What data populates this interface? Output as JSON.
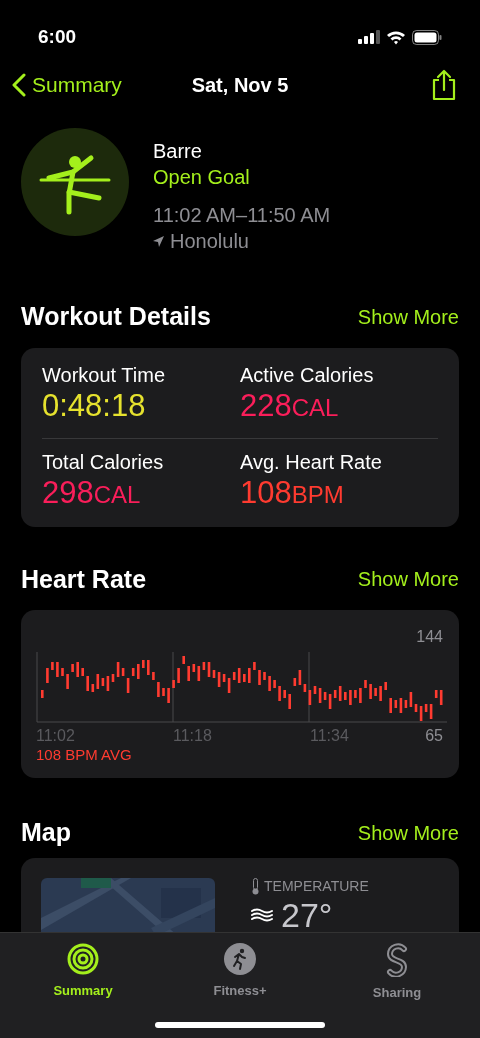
{
  "status_bar": {
    "time": "6:00"
  },
  "nav": {
    "back": "Summary",
    "title": "Sat, Nov 5"
  },
  "workout": {
    "name": "Barre",
    "goal": "Open Goal",
    "time_range": "11:02 AM–11:50 AM",
    "location": "Honolulu"
  },
  "details": {
    "title": "Workout Details",
    "action": "Show More",
    "metrics": [
      {
        "label": "Workout Time",
        "value": "0:48:18",
        "color": "#e6e22e"
      },
      {
        "label": "Active Calories",
        "value": "228",
        "unit": "CAL",
        "color": "#fa1e5a"
      },
      {
        "label": "Total Calories",
        "value": "298",
        "unit": "CAL",
        "color": "#fa1e5a"
      },
      {
        "label": "Avg. Heart Rate",
        "value": "108",
        "unit": "BPM",
        "color": "#ff3b30"
      }
    ]
  },
  "heart_rate": {
    "title": "Heart Rate",
    "action": "Show More",
    "max": "144",
    "min": "65",
    "times": [
      "11:02",
      "11:18",
      "11:34"
    ],
    "average": "108 BPM AVG"
  },
  "map": {
    "title": "Map",
    "action": "Show More",
    "temperature_label": "TEMPERATURE",
    "temperature": "27°"
  },
  "tabs": [
    {
      "label": "Summary",
      "selected": true,
      "kind": "rings"
    },
    {
      "label": "Fitness+",
      "selected": false,
      "kind": "runner"
    },
    {
      "label": "Sharing",
      "selected": false,
      "kind": "sharing"
    }
  ]
}
